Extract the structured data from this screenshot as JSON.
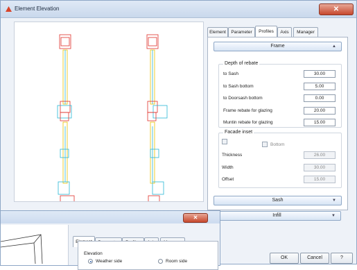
{
  "window": {
    "title": "Element Elevation"
  },
  "tabs": [
    {
      "label": "Element"
    },
    {
      "label": "Parameter"
    },
    {
      "label": "Profiles"
    },
    {
      "label": "Axis"
    },
    {
      "label": "Manager"
    }
  ],
  "frame": {
    "title": "Frame",
    "depth_group": "Depth of rebate",
    "rows": [
      {
        "label": "to Sash",
        "value": "30.00"
      },
      {
        "label": "to Sash bottom",
        "value": "5.00"
      },
      {
        "label": "to Doorsash bottom",
        "value": "0.00"
      },
      {
        "label": "Frame rebate for glazing",
        "value": "20.00"
      },
      {
        "label": "Muntin rebate for glazing",
        "value": "15.00"
      }
    ],
    "facade_group": "Facade inset",
    "bottom_label": "Bottom",
    "thickness": {
      "label": "Thickness",
      "value": "26.00"
    },
    "width": {
      "label": "Width",
      "value": "30.00"
    },
    "offset": {
      "label": "Offset",
      "value": "15.00"
    }
  },
  "sections": {
    "sash": "Sash",
    "infill": "Infill"
  },
  "buttons": {
    "ok": "OK",
    "cancel": "Cancel",
    "help": "?"
  },
  "window2": {
    "tabs": [
      {
        "label": "Element"
      },
      {
        "label": "Parameter"
      },
      {
        "label": "Profiles"
      },
      {
        "label": "Axis"
      },
      {
        "label": "Manager"
      }
    ],
    "elevation_label": "Elevation",
    "weather_side": "Weather side",
    "room_side": "Room side"
  },
  "colors": {
    "accent": "#2d5da8",
    "frame_red": "#e0302a",
    "sash_cyan": "#29b7d6",
    "glass_yellow": "#e8c200"
  }
}
